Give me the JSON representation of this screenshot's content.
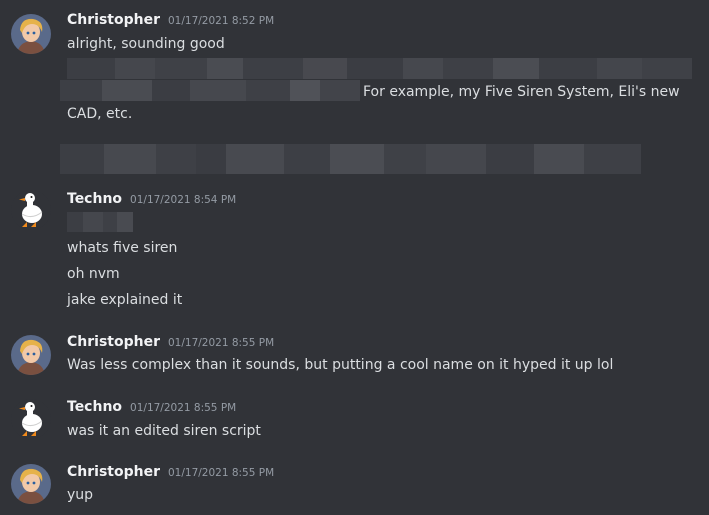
{
  "messages": [
    {
      "author": "Christopher",
      "timestamp": "01/17/2021 8:52 PM",
      "lines": [
        "alright, sounding good",
        "For example, my Five Siren System, Eli's new",
        "CAD, etc."
      ]
    },
    {
      "author": "Techno",
      "timestamp": "01/17/2021 8:54 PM",
      "lines": [
        "whats five siren",
        "oh nvm",
        "jake explained it"
      ]
    },
    {
      "author": "Christopher",
      "timestamp": "01/17/2021 8:55 PM",
      "lines": [
        "Was less complex than it sounds, but putting a cool name on it hyped it up lol"
      ]
    },
    {
      "author": "Techno",
      "timestamp": "01/17/2021 8:55 PM",
      "lines": [
        "was it an edited siren script"
      ]
    },
    {
      "author": "Christopher",
      "timestamp": "01/17/2021 8:55 PM",
      "lines": [
        "yup"
      ]
    }
  ],
  "colors": {
    "background": "#313338",
    "text": "#dbdee1",
    "username": "#f2f3f5",
    "timestamp": "#949ba4"
  }
}
